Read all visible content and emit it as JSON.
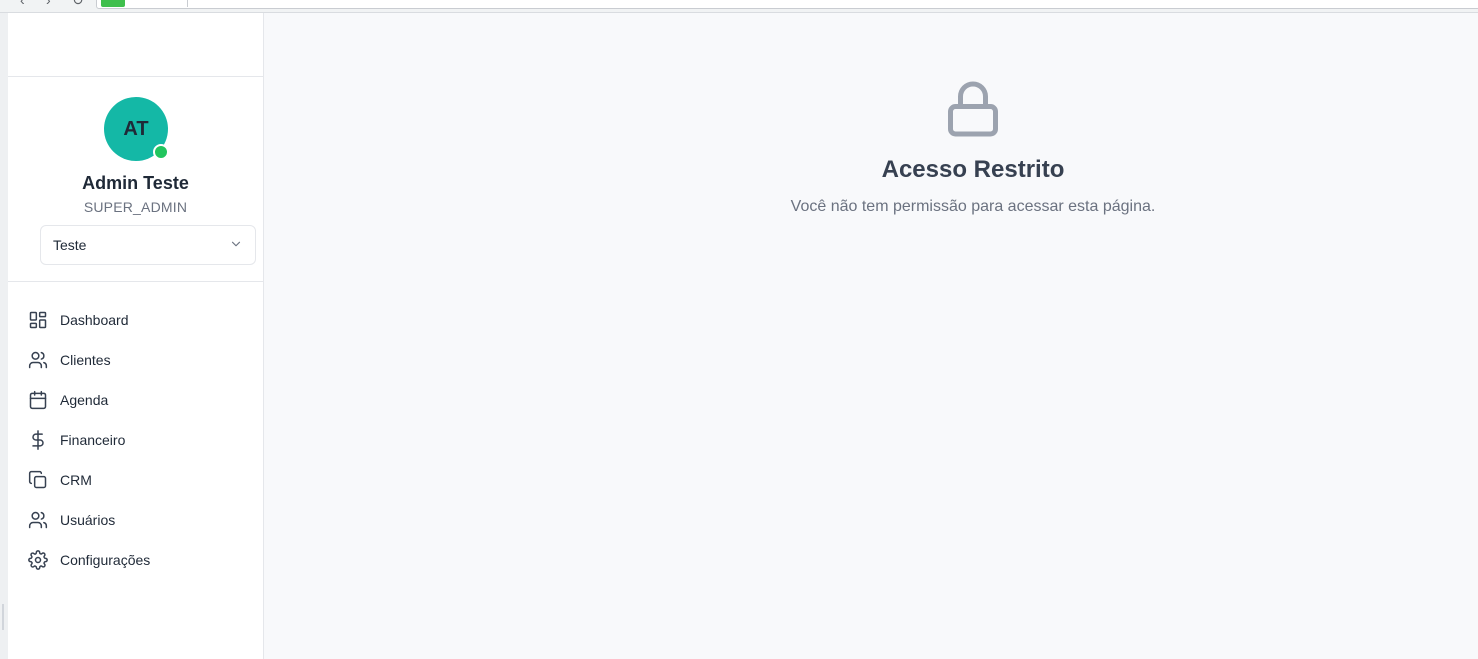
{
  "sidebar": {
    "profile": {
      "initials": "AT",
      "name": "Admin Teste",
      "role": "SUPER_ADMIN",
      "tenant_selected": "Teste",
      "online_color": "#22c55e"
    },
    "nav": [
      {
        "label": "Dashboard",
        "icon": "dashboard-grid-icon"
      },
      {
        "label": "Clientes",
        "icon": "users-icon"
      },
      {
        "label": "Agenda",
        "icon": "calendar-icon"
      },
      {
        "label": "Financeiro",
        "icon": "dollar-icon"
      },
      {
        "label": "CRM",
        "icon": "copy-icon"
      },
      {
        "label": "Usuários",
        "icon": "users-icon"
      },
      {
        "label": "Configurações",
        "icon": "gear-icon"
      }
    ]
  },
  "main": {
    "title": "Acesso Restrito",
    "message": "Você não tem permissão para acessar esta página.",
    "icon": "lock-icon"
  },
  "colors": {
    "avatar_bg": "#14b8a6",
    "page_bg": "#f8f9fb",
    "muted_text": "#6b7280"
  }
}
